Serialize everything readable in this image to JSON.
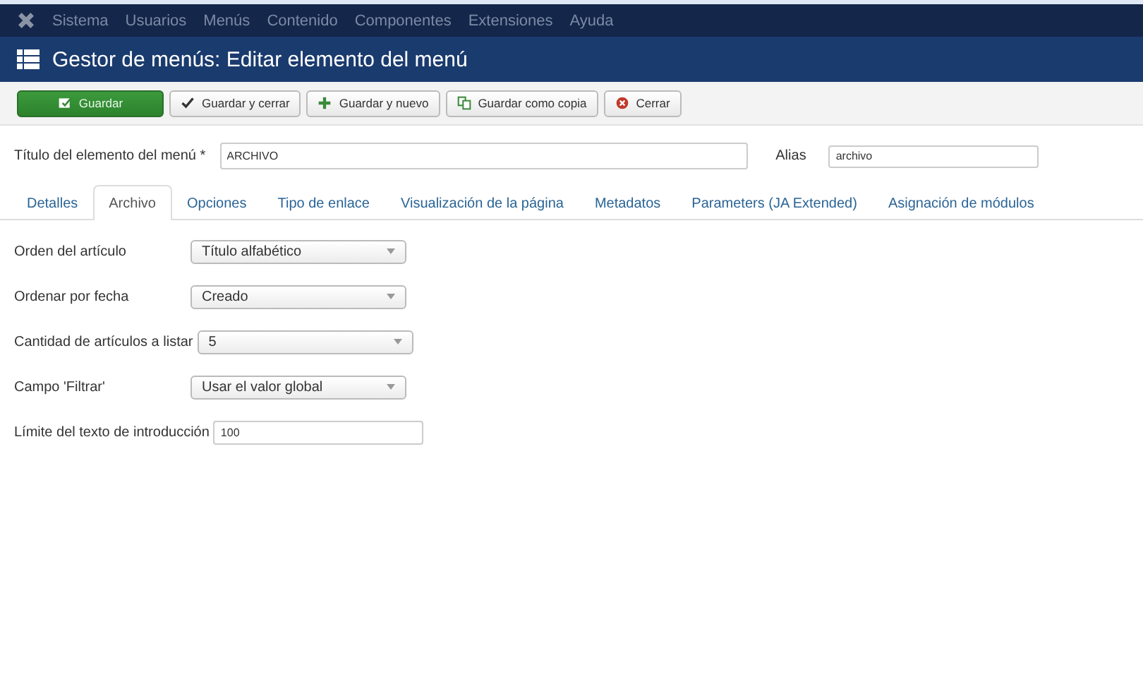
{
  "menubar": {
    "items": [
      "Sistema",
      "Usuarios",
      "Menús",
      "Contenido",
      "Componentes",
      "Extensiones",
      "Ayuda"
    ]
  },
  "header": {
    "title": "Gestor de menús: Editar elemento del menú"
  },
  "toolbar": [
    {
      "label": "Guardar",
      "kind": "save",
      "primary": true
    },
    {
      "label": "Guardar y cerrar",
      "kind": "check",
      "primary": false
    },
    {
      "label": "Guardar y nuevo",
      "kind": "plus",
      "primary": false
    },
    {
      "label": "Guardar como copia",
      "kind": "copy",
      "primary": false
    },
    {
      "label": "Cerrar",
      "kind": "close",
      "primary": false
    }
  ],
  "title_field": {
    "label": "Título del elemento del menú *",
    "value": "ARCHIVO"
  },
  "alias_field": {
    "label": "Alias",
    "value": "archivo"
  },
  "tabs": [
    {
      "label": "Detalles",
      "selected": false
    },
    {
      "label": "Archivo",
      "selected": true
    },
    {
      "label": "Opciones",
      "selected": false
    },
    {
      "label": "Tipo de enlace",
      "selected": false
    },
    {
      "label": "Visualización de la página",
      "selected": false
    },
    {
      "label": "Metadatos",
      "selected": false
    },
    {
      "label": "Parameters (JA Extended)",
      "selected": false
    },
    {
      "label": "Asignación de módulos",
      "selected": false
    }
  ],
  "fields": [
    {
      "label": "Orden del artículo",
      "kind": "select",
      "value": "Título alfabético"
    },
    {
      "label": "Ordenar por fecha",
      "kind": "select",
      "value": "Creado"
    },
    {
      "label": "Cantidad de artículos a listar",
      "kind": "select",
      "value": "5"
    },
    {
      "label": "Campo 'Filtrar'",
      "kind": "select",
      "value": "Usar el valor global"
    },
    {
      "label": "Límite del texto de introducción",
      "kind": "text",
      "value": "100"
    }
  ]
}
